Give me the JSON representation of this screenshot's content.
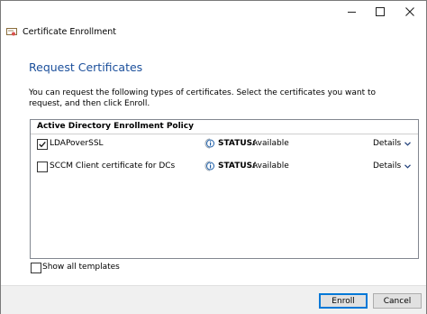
{
  "window": {
    "title": "Certificate Enrollment",
    "icons": {
      "app": "certificate-icon",
      "minimize": "minimize-icon",
      "maximize": "maximize-icon",
      "close": "close-icon"
    }
  },
  "page": {
    "section_title": "Request Certificates",
    "description": "You can request the following types of certificates. Select the certificates you want to request, and then click Enroll."
  },
  "policy": {
    "title": "Active Directory Enrollment Policy",
    "certificates": [
      {
        "name": "LDAPoverSSL",
        "checked": true,
        "status_label": "STATUS:",
        "status_value": "Available",
        "details_label": "Details"
      },
      {
        "name": "SCCM Client certificate for DCs",
        "checked": false,
        "status_label": "STATUS:",
        "status_value": "Available",
        "details_label": "Details"
      }
    ]
  },
  "options": {
    "show_all_label": "Show all templates",
    "show_all_checked": false
  },
  "footer": {
    "enroll_label": "Enroll",
    "cancel_label": "Cancel"
  },
  "colors": {
    "accent": "#1b4f9b",
    "info_icon": "#1f5fa8",
    "focus_border": "#0078d7"
  }
}
